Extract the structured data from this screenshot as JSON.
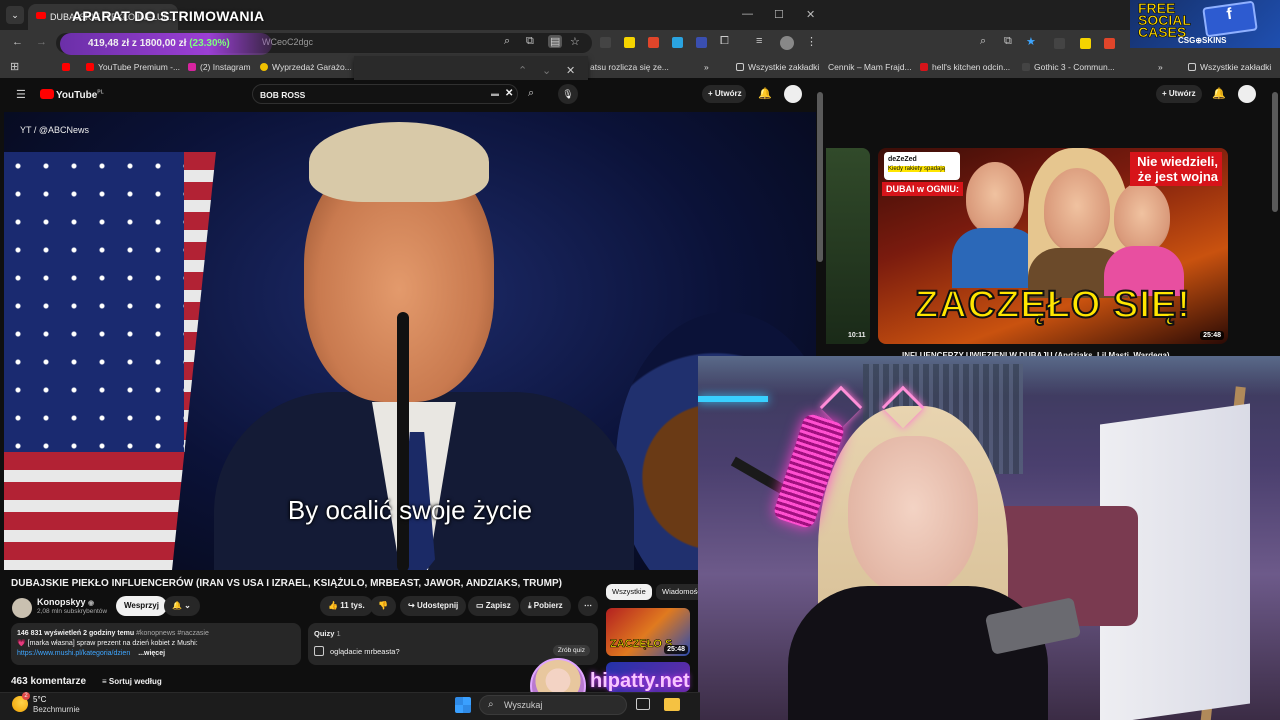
{
  "stream_overlay": {
    "title": "APARAT DO STRIMOWANIA",
    "price_text": "419,48 zł z 1800,00 zł",
    "price_pct": "(23.30%)",
    "streamer_name": "hipatty.net"
  },
  "left_browser": {
    "tab_title": "DUBAJSKIE PIEKŁO INFLUE...",
    "url_fragment": "WCeoC2dgc",
    "bookmarks": [
      {
        "label": "YouTube Premium -..."
      },
      {
        "label": "(2) Instagram"
      },
      {
        "label": "Wyprzedaż Garażo..."
      },
      {
        "label": "atsu rozlicza się ze..."
      },
      {
        "label": "Wszystkie zakładki"
      }
    ],
    "youtube": {
      "logo": "YouTube",
      "logo_country": "PL",
      "search_value": "BOB ROSS",
      "create_label": "Utwórz",
      "video_watermark": "YT / @ABCNews",
      "subtitle": "By ocalić swoje życie",
      "video_title": "DUBAJSKIE PIEKŁO INFLUENCERÓW (IRAN VS USA I IZRAEL, KSIĄŻULO, MRBEAST, JAWOR, ANDZIAKS, TRUMP)",
      "channel_name": "Konopskyy",
      "channel_subs": "2,08 mln subskrybentów",
      "support_label": "Wesprzyj",
      "likes": "11 tys.",
      "share_label": "Udostępnij",
      "save_label": "Zapisz",
      "download_label": "Pobierz",
      "description": {
        "stats": "146 831 wyświetleń  2 godziny temu",
        "tags": "#konopnews #naczasie",
        "line1": "💗 [marka własna] spraw prezent na dzień kobiet z Mushi:",
        "link": "https://www.mushi.pl/kategoria/dzien",
        "more": "...więcej"
      },
      "quiz": {
        "label": "Quizy",
        "count": "1",
        "question": "oglądacie mrbeasta?",
        "make_quiz": "Zrób quiz"
      },
      "comments_count": "463 komentarze",
      "sort_label": "Sortuj według",
      "chips": [
        {
          "label": "Wszystkie",
          "active": true
        },
        {
          "label": "Wiadomości",
          "active": false
        }
      ],
      "side_thumb_text": "ZACZĘŁO S",
      "side_thumb_duration": "25:48"
    }
  },
  "right_browser": {
    "bookmarks": [
      {
        "label": "Cennik – Mam Frajd..."
      },
      {
        "label": "hell's kitchen odcin..."
      },
      {
        "label": "Gothic 3 - Commun..."
      },
      {
        "label": "Wszystkie zakładki"
      }
    ],
    "create_label": "Utwórz",
    "thumbnail": {
      "headline": "ZACZĘŁO SIĘ!",
      "callout": "Nie wiedzieli, że jest wojna",
      "tag": "DUBAI w OGNIU:",
      "tweet_handle": "deZeZed",
      "tweet_sub": "Kiedy rakiety spadają",
      "duration": "25:48"
    },
    "left_thumb_duration": "10:11",
    "next_title": "INFLUENCERZY UWIĘZIENI W DUBAJU (Andziaks, Lil Masti, Wardega)"
  },
  "sponsor": {
    "line1": "FREE",
    "line2": "SOCIAL",
    "line3": "CASES",
    "brand": "CSG⊕SKINS"
  },
  "taskbar": {
    "temp": "5°C",
    "weather": "Bezchmurnie",
    "search_placeholder": "Wyszukaj"
  },
  "colors": {
    "youtube_red": "#ff0000",
    "bg": "#0f0f0f",
    "panel": "#272727",
    "accent_purple": "#9b3fd4",
    "green_pct": "#7dff7d",
    "thumb_yellow": "#ffe600"
  }
}
